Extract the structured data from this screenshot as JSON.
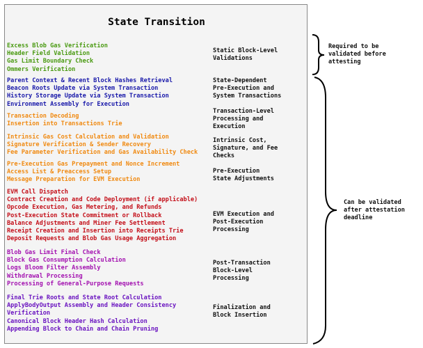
{
  "title": "State Transition",
  "colors": {
    "green": "#4a9a12",
    "blue": "#1a1aaa",
    "orange": "#f08a12",
    "red": "#c4101a",
    "magenta": "#a312b0",
    "purple": "#6a14c0"
  },
  "groups": [
    {
      "label": "Static Block-Level Validations",
      "color": "green",
      "items": [
        "Excess Blob Gas Verification",
        "Header Field Validation",
        "Gas Limit Boundary Check",
        "Ommers Verification"
      ]
    },
    {
      "label": "State-Dependent Pre-Execution and System Transactions",
      "color": "blue",
      "items": [
        "Parent Context & Recent Block Hashes Retrieval",
        "Beacon Roots Update via System Transaction",
        "History Storage Update via System Transaction",
        "Environment Assembly for Execution"
      ]
    },
    {
      "label": "Transaction-Level Processing and Execution",
      "color": "orange",
      "items": [
        "Transaction Decoding",
        "Insertion into Transactions Trie"
      ]
    },
    {
      "label": "Intrinsic Cost, Signature, and Fee Checks",
      "color": "orange",
      "items": [
        "Intrinsic Gas Cost Calculation and Validation",
        "Signature Verification & Sender Recovery",
        "Fee Parameter Verification and Gas Availability Check"
      ]
    },
    {
      "label": "Pre-Execution State Adjustments",
      "color": "orange",
      "items": [
        "Pre-Execution Gas Prepayment and Nonce Increment",
        "Access List & Preaccess Setup",
        "Message Preparation for EVM Execution"
      ]
    },
    {
      "label": "EVM Execution and Post-Execution Processing",
      "color": "red",
      "items": [
        "EVM Call Dispatch",
        "Contract Creation and Code Deployment (if applicable)",
        "Opcode Execution, Gas Metering, and Refunds",
        "Post-Execution State Commitment or Rollback",
        "Balance Adjustments and Miner Fee Settlement",
        "Receipt Creation and Insertion into Receipts Trie",
        "Deposit Requests and Blob Gas Usage Aggregation"
      ]
    },
    {
      "label": "Post-Transaction Block-Level Processing",
      "color": "magenta",
      "items": [
        "Blob Gas Limit Final Check",
        "Block Gas Consumption Calculation",
        "Logs Bloom Filter Assembly",
        "Withdrawal Processing",
        "Processing of General-Purpose Requests"
      ]
    },
    {
      "label": "Finalization and Block Insertion",
      "color": "purple",
      "items": [
        "Final Trie Roots and State Root Calculation",
        "ApplyBodyOutput Assembly and Header Consistency",
        "Verification",
        "Canonical Block Header Hash Calculation",
        "Appending Block to Chain and Chain Pruning"
      ]
    }
  ],
  "labels_lines": [
    [
      "Static Block-Level",
      "Validations"
    ],
    [
      "State-Dependent",
      "Pre-Execution and",
      "System Transactions"
    ],
    [
      "Transaction-Level",
      "Processing and",
      "Execution"
    ],
    [
      "Intrinsic Cost,",
      "Signature, and Fee",
      "Checks"
    ],
    [
      "Pre-Execution",
      "State Adjustments"
    ],
    [
      "EVM Execution and",
      "Post-Execution",
      "Processing"
    ],
    [
      "Post-Transaction",
      "Block-Level",
      "Processing"
    ],
    [
      "Finalization and",
      "Block Insertion"
    ]
  ],
  "annotations": {
    "before": [
      "Required to be",
      "validated before",
      "attesting"
    ],
    "after": [
      "Can be validated",
      "after attestation",
      "deadline"
    ]
  }
}
